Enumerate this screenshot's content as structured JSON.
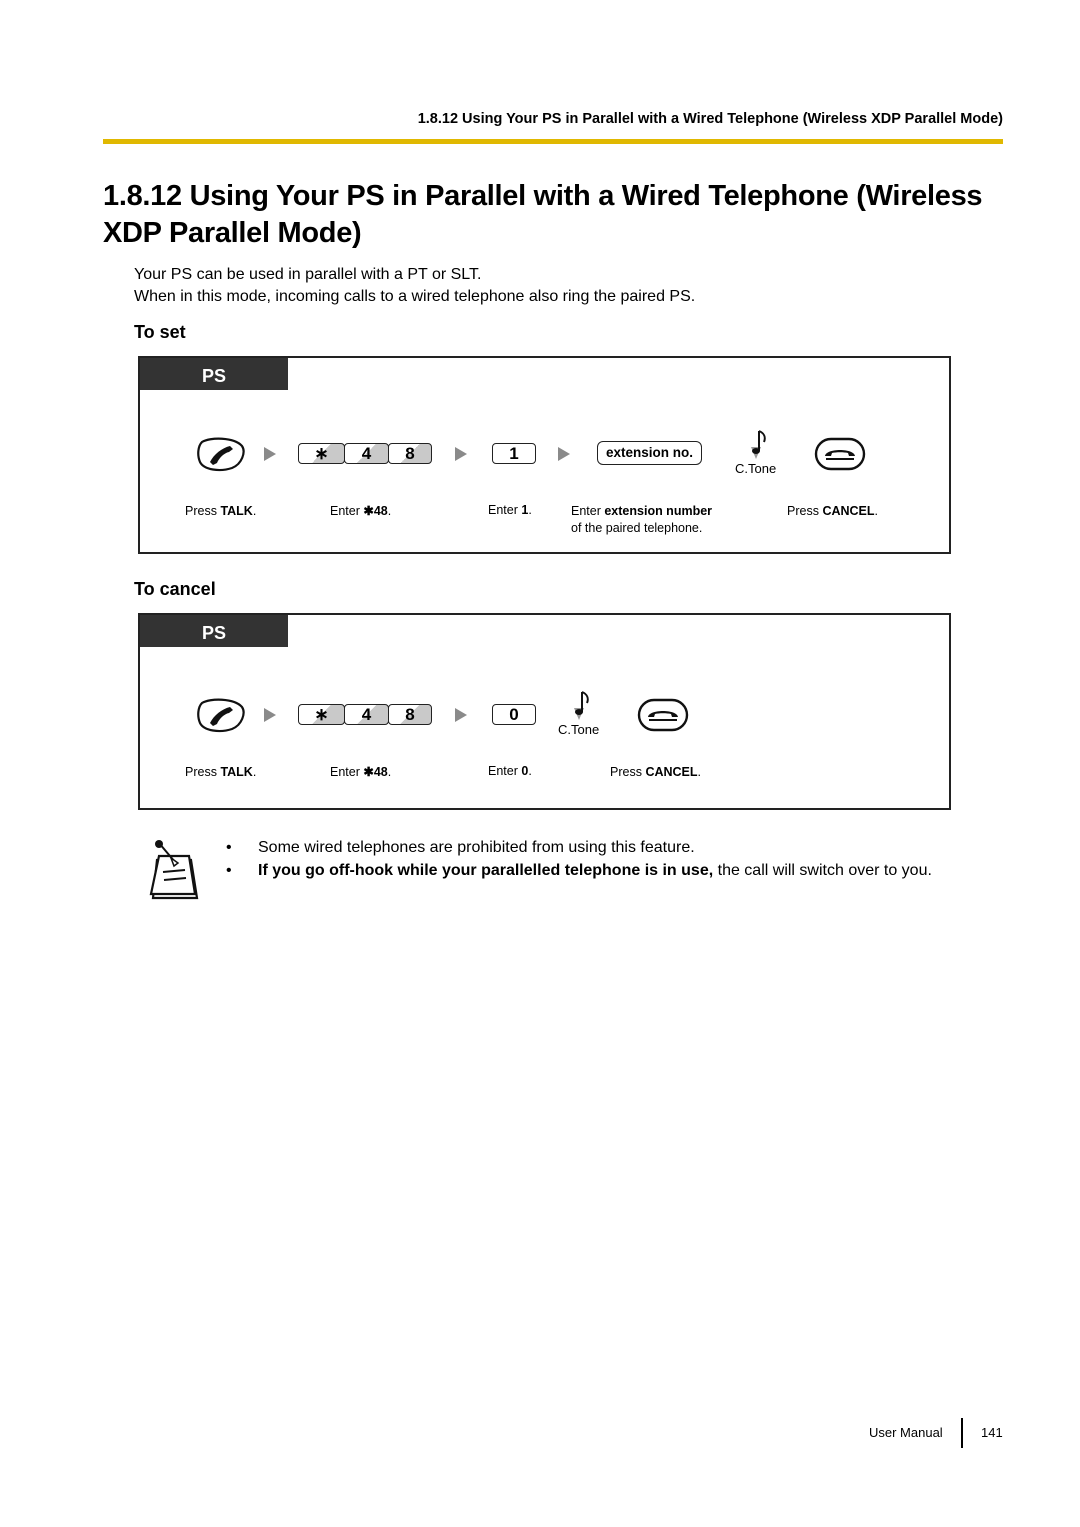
{
  "header": {
    "running_title": "1.8.12 Using Your PS in Parallel with a Wired Telephone (Wireless XDP Parallel Mode)",
    "accent_color": "#e0b800"
  },
  "title": "1.8.12  Using Your PS in Parallel with a Wired Telephone (Wireless XDP Parallel Mode)",
  "intro": [
    "Your PS can be used in parallel with a PT or SLT.",
    "When in this mode, incoming calls to a wired telephone also ring the paired PS."
  ],
  "to_set": {
    "heading": "To set",
    "tab_label": "PS",
    "keys": {
      "star": "∗",
      "four": "4",
      "eight": "8",
      "digit": "1",
      "ext": "extension no."
    },
    "tone_label": "C.Tone",
    "icons": [
      "talk-icon",
      "arrow-icon",
      "key-star-icon",
      "arrow-icon",
      "key-1-icon",
      "arrow-icon",
      "extension-key-icon",
      "confirmation-tone-icon",
      "cancel-icon"
    ],
    "steps": {
      "talk_pre": "Press ",
      "talk_bold": "TALK",
      "talk_post": ".",
      "code_pre": "Enter ",
      "code_bold": "✱48",
      "code_post": ".",
      "digit_pre": "Enter ",
      "digit_bold": "1",
      "digit_post": ".",
      "ext_pre": "Enter ",
      "ext_bold": "extension number",
      "ext_line2": "of the paired telephone.",
      "cancel_pre": "Press ",
      "cancel_bold": "CANCEL",
      "cancel_post": "."
    }
  },
  "to_cancel": {
    "heading": "To cancel",
    "tab_label": "PS",
    "keys": {
      "star": "∗",
      "four": "4",
      "eight": "8",
      "digit": "0"
    },
    "tone_label": "C.Tone",
    "steps": {
      "talk_pre": "Press ",
      "talk_bold": "TALK",
      "talk_post": ".",
      "code_pre": "Enter ",
      "code_bold": "✱48",
      "code_post": ".",
      "digit_pre": "Enter ",
      "digit_bold": "0",
      "digit_post": ".",
      "cancel_pre": "Press ",
      "cancel_bold": "CANCEL",
      "cancel_post": "."
    }
  },
  "notes": {
    "bullet": "•",
    "items": [
      {
        "bold": "",
        "text": "Some wired telephones are prohibited from using this feature."
      },
      {
        "bold": "If you go off-hook while your parallelled telephone is in use,",
        "text": " the call will switch over to you."
      }
    ]
  },
  "footer": {
    "label": "User Manual",
    "page": "141"
  }
}
